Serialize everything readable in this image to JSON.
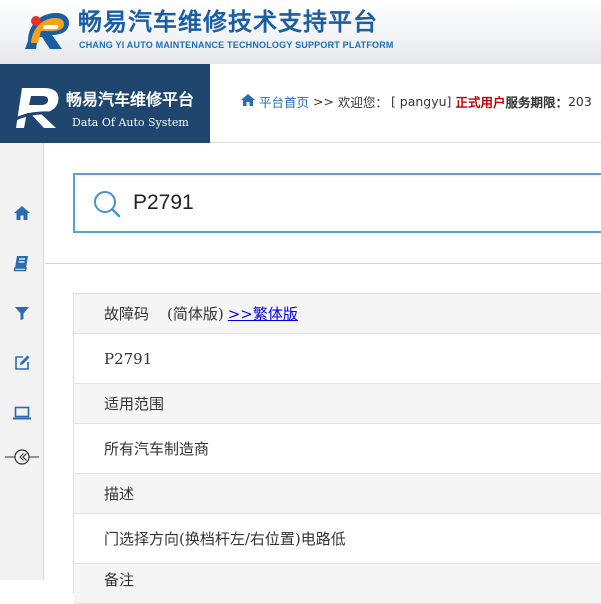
{
  "banner": {
    "title": "畅易汽车维修技术支持平台",
    "subtitle": "CHANG YI AUTO MAINTENANCE TECHNOLOGY SUPPORT PLATFORM"
  },
  "brand": {
    "title": "畅易汽车维修平台",
    "subtitle": "Data Of Auto System"
  },
  "topbar": {
    "home_link": "平台首页",
    "separator": " >> ",
    "welcome": "欢迎您：",
    "username": "[ pangyu]",
    "user_type": "正式用户",
    "service_label": "服务期限：",
    "service_value": "203"
  },
  "search": {
    "value": "P2791"
  },
  "result": {
    "code_heading": "故障码",
    "simplified_label": "(简体版)",
    "traditional_link": ">>繁体版",
    "code_value": "P2791",
    "scope_heading": "适用范围",
    "scope_value": "所有汽车制造商",
    "desc_heading": "描述",
    "desc_value": "门选择方向(换档杆左/右位置)电路低",
    "notes_heading": "备注"
  },
  "colors": {
    "brand_bg": "#1e466e",
    "accent": "#2b6cb0",
    "user_type": "#c00000",
    "search_border": "#5aa0d6"
  },
  "icons": [
    "home-icon",
    "book-icon",
    "filter-icon",
    "edit-icon",
    "laptop-icon",
    "collapse-icon",
    "search-icon"
  ]
}
